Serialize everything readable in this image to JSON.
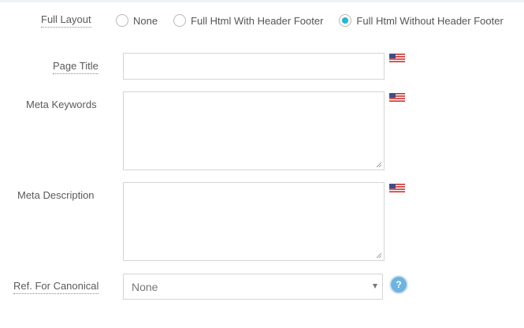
{
  "full_layout": {
    "label": "Full Layout",
    "options": [
      "None",
      "Full Html With Header Footer",
      "Full Html Without Header Footer"
    ],
    "selected": "Full Html Without Header Footer"
  },
  "page_title": {
    "label": "Page Title",
    "value": ""
  },
  "meta_keywords": {
    "label": "Meta Keywords",
    "value": ""
  },
  "meta_description": {
    "label": "Meta Description",
    "value": ""
  },
  "canonical": {
    "label": "Ref. For Canonical",
    "selected": "None",
    "help_symbol": "?"
  },
  "icons": {
    "language_flag": "us-flag-icon",
    "help": "help-icon"
  },
  "colors": {
    "radio_accent": "#25b7d3",
    "help_button": "#6fb3e0"
  }
}
